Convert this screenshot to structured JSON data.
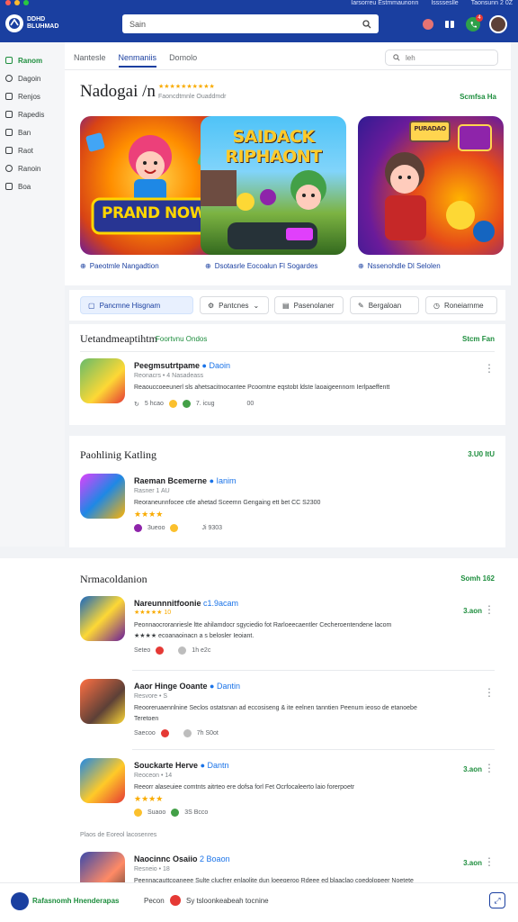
{
  "header": {
    "logo_text": "DDHD BLUHMAD",
    "search_placeholder": "Sain",
    "top_meta": [
      "Iarsorreu  Estmmaunonn",
      "Isssseslle",
      "Taonsunn  2 0Z"
    ]
  },
  "sidebar": {
    "items": [
      {
        "label": "Ranom",
        "active": true
      },
      {
        "label": "Dagoin"
      },
      {
        "label": "Renjos"
      },
      {
        "label": "Rapedis"
      },
      {
        "label": "Ban"
      },
      {
        "label": "Raot"
      },
      {
        "label": "Ranoin"
      },
      {
        "label": "Boa"
      }
    ]
  },
  "main": {
    "tabs": [
      {
        "label": "Nantesle"
      },
      {
        "label": "Nenmaniis",
        "active": true
      },
      {
        "label": "Domolo"
      }
    ],
    "search_placeholder": "leh",
    "title": "Nadogai /n",
    "title_sub": "Faoncdtmnle Ouaddmdr",
    "see_all": "Scmfsa Ha",
    "featured": [
      {
        "art": "PRAND NOW",
        "caption": "Paeotmle Nangadtion"
      },
      {
        "art": "SAIDACK RIPHAONT",
        "caption": "Dsotasrle Eocoalun Fl Sogardes"
      },
      {
        "art": "PURADAO",
        "caption": "Nssenohdle Dl Selolen"
      }
    ]
  },
  "filters": [
    {
      "label": "Pancmne Hisgnam",
      "active": true
    },
    {
      "label": "Pantcnes"
    },
    {
      "label": "Pasenolaner"
    },
    {
      "label": "Bergaloan"
    },
    {
      "label": "Roneiarnme"
    }
  ],
  "sections": [
    {
      "title": "Uetandmeaptihtm",
      "subtitle": "Foortvnu Ondos",
      "see_all": "Stcm Fan",
      "apps": [
        {
          "name": "Peegmsutrtpame",
          "dev": "Daoin",
          "meta": "Reonacrs • 4 Nasadeass",
          "desc": "Reaouccoeeunerl sls ahetsacitnocantee Pcoomtne eqstobt ldste laoaigeennorn Ierlpaeffentt",
          "stats": [
            "5 hcao",
            "7. icug",
            "00"
          ]
        }
      ]
    },
    {
      "title": "Paohlinig Katling",
      "see_all": "3.U0 ItU",
      "apps": [
        {
          "name": "Raeman Bcemerne",
          "dev": "Ianim",
          "meta": "Rasner 1 AU",
          "desc": "Reoraneunnfocee ctle ahetad Sceemn Gengaing ett bet CC S2300",
          "stars": "★★★★",
          "stats": [
            "3ueoo",
            "Ji 9303"
          ]
        }
      ]
    },
    {
      "title": "Nrmacoldanion",
      "see_all": "Somh 162",
      "apps": [
        {
          "name": "Nareunnnitfoonie",
          "dev": "c1.9acam",
          "meta": "",
          "stars": "★★★★★ 10",
          "desc": "Peonnaocroranriesle ltte ahilamdocr sgyciedio fot Rarloeecaentler Cecheroentendene lacom",
          "desc2": "★★★★ ecoanaoinacn a s belosler Ieoiant.",
          "stats": [
            "Seteo",
            "1h e2c"
          ],
          "price": "3.aon"
        },
        {
          "name": "Aaor Hinge Ooante",
          "dev": "Dantin",
          "meta": "Resvore • S",
          "desc": "Reooreruaennlnine Seclos ostatsnan ad eccosiseng & ite eelnen tanntien Peenum ieoso de etanoebe",
          "desc2": "Teretoen",
          "stats": [
            "Saecoo",
            "7h S0ot"
          ]
        },
        {
          "name": "Souckarte Herve",
          "dev": "Dantn",
          "meta": "Reoceon • 14",
          "stars": "★★★★",
          "desc": "Reeorr alaseuiee comtnts aitrteo ere dofsa forl Fet Ocrfocaleerto laio forerpoetr",
          "stats": [
            "Suaoo",
            "3S Bcco"
          ],
          "price": "3.aon"
        }
      ]
    }
  ],
  "sub_label": "Plaos de Eoreol lacosenres",
  "last_app": {
    "name": "Naocinnc Osaiio",
    "dev": "2 Boaon",
    "meta": "Resneio • 18",
    "desc": "Peennacauttcoaneee Sulte clucfrer enlaolite dun loeegeroo Rdeee ed blaaclao coedolopeer Noetete",
    "price": "3.aon"
  },
  "bottom": {
    "label": "Rafasnomh Hnenderapas",
    "status": "Pecon",
    "extra": "Sy tsloonkeabeah tocnine"
  }
}
